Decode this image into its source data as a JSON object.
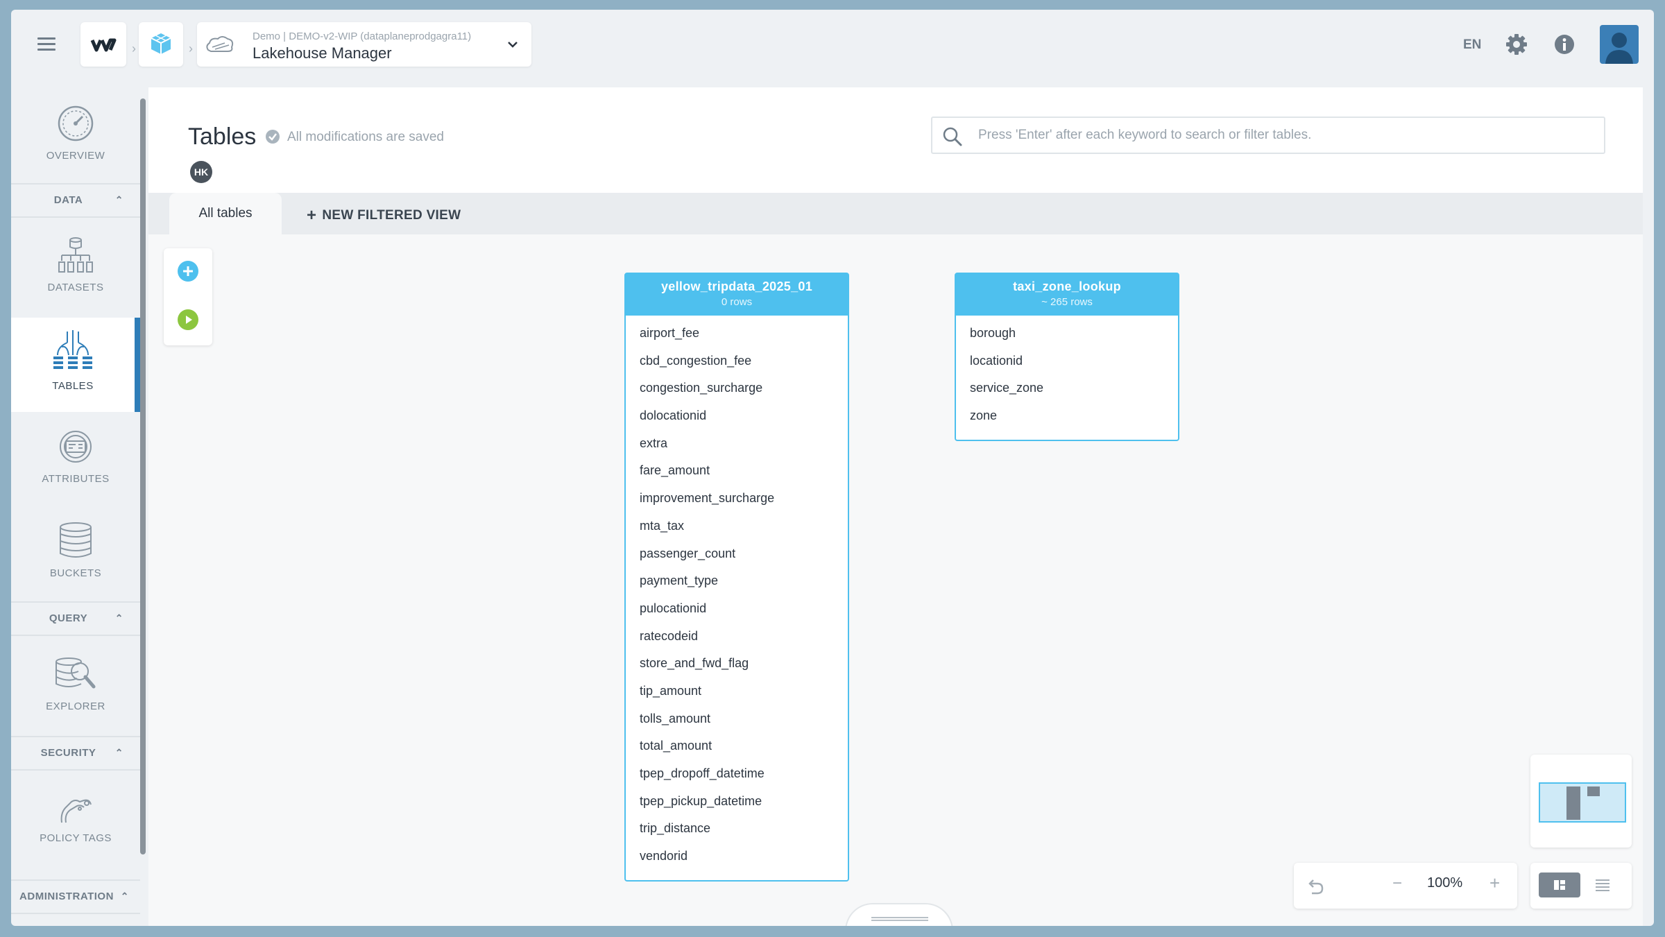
{
  "header": {
    "breadcrumb_sub": "Demo | DEMO-v2-WIP (dataplaneprodgagra11)",
    "breadcrumb_title": "Lakehouse Manager",
    "language": "EN"
  },
  "sidebar": {
    "overview": "OVERVIEW",
    "section_data": "DATA",
    "datasets": "DATASETS",
    "tables": "TABLES",
    "attributes": "ATTRIBUTES",
    "buckets": "BUCKETS",
    "section_query": "QUERY",
    "explorer": "EXPLORER",
    "section_security": "SECURITY",
    "policy_tags": "POLICY TAGS",
    "section_administration": "ADMINISTRATION"
  },
  "main": {
    "title": "Tables",
    "saved_status": "All modifications are saved",
    "user_initials": "HK",
    "search_placeholder": "Press 'Enter' after each keyword to search or filter tables.",
    "tabs": {
      "all_tables": "All tables",
      "new_filtered_view": "NEW FILTERED VIEW"
    }
  },
  "tables": [
    {
      "name": "yellow_tripdata_2025_01",
      "rows": "0 rows",
      "columns": [
        "airport_fee",
        "cbd_congestion_fee",
        "congestion_surcharge",
        "dolocationid",
        "extra",
        "fare_amount",
        "improvement_surcharge",
        "mta_tax",
        "passenger_count",
        "payment_type",
        "pulocationid",
        "ratecodeid",
        "store_and_fwd_flag",
        "tip_amount",
        "tolls_amount",
        "total_amount",
        "tpep_dropoff_datetime",
        "tpep_pickup_datetime",
        "trip_distance",
        "vendorid"
      ]
    },
    {
      "name": "taxi_zone_lookup",
      "rows": "~ 265 rows",
      "columns": [
        "borough",
        "locationid",
        "service_zone",
        "zone"
      ]
    }
  ],
  "zoom": {
    "level": "100%"
  },
  "colors": {
    "accent": "#4ec0ee",
    "active_bar": "#2e7db8",
    "add_button": "#4ec0ee",
    "run_button": "#8cc63f"
  }
}
